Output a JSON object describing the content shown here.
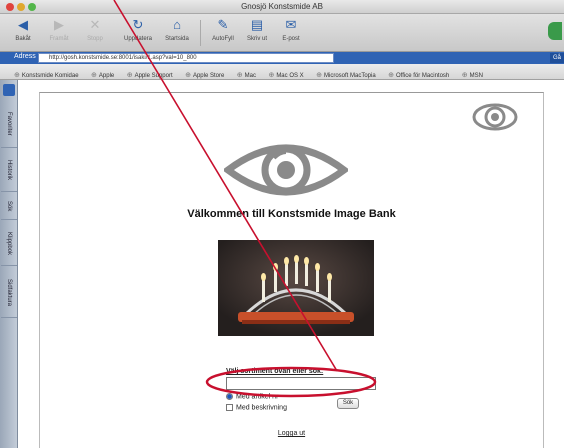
{
  "window": {
    "title": "Gnosjö Konstsmide AB"
  },
  "toolbar": {
    "buttons": [
      {
        "label": "Bakåt",
        "icon": "back-arrow-icon",
        "enabled": true
      },
      {
        "label": "Framåt",
        "icon": "forward-arrow-icon",
        "enabled": false
      },
      {
        "label": "Stopp",
        "icon": "stop-icon",
        "enabled": false
      },
      {
        "label": "Uppdatera",
        "icon": "refresh-icon",
        "enabled": true
      },
      {
        "label": "Startsida",
        "icon": "home-icon",
        "enabled": true
      },
      {
        "label": "AutoFyll",
        "icon": "autofill-icon",
        "enabled": true
      },
      {
        "label": "Skriv ut",
        "icon": "print-icon",
        "enabled": true
      },
      {
        "label": "E-post",
        "icon": "mail-icon",
        "enabled": true
      }
    ]
  },
  "address": {
    "label": "Adress",
    "url": "http://gosh.konstsmide.se:8001/isaki/1.asp?val=10_800",
    "go": "Gå"
  },
  "favorites": [
    "Konstsmide Komidae",
    "Apple",
    "Apple Support",
    "Apple Store",
    "Mac",
    "Mac OS X",
    "Microsoft MacTopia",
    "Office för Macintosh",
    "MSN"
  ],
  "sidebar": {
    "tabs": [
      "Favoriter",
      "Historik",
      "Sök",
      "Klippbok",
      "Sidfaktura"
    ]
  },
  "page": {
    "welcome": "Välkommen till Konstsmide Image Bank",
    "prompt": "Välj sortiment ovan eller sök:",
    "search_value": "",
    "radio_label": "Med artikel nr",
    "checkbox_label": "Med beskrivning",
    "search_button": "Sök",
    "logout": "Logga ut"
  },
  "colors": {
    "address_bar": "#2f63b4",
    "annotation": "#c8102e",
    "eye_logo": "#8a8a8a"
  }
}
